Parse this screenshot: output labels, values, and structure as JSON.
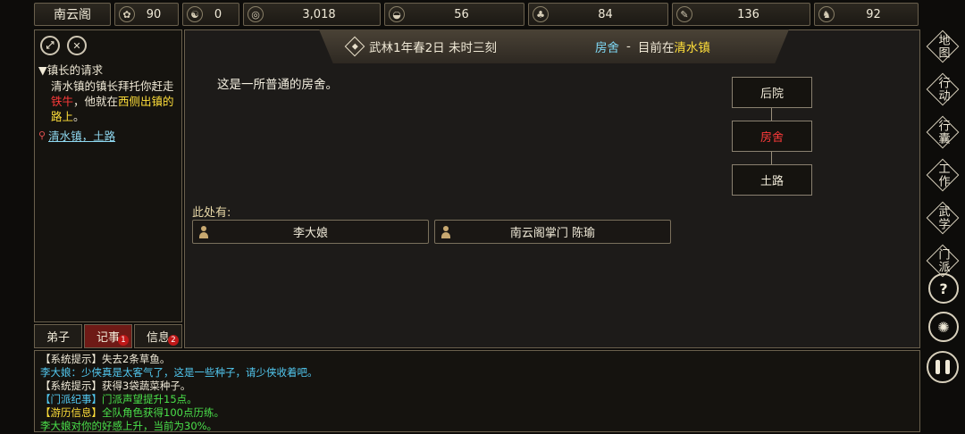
{
  "topbar": {
    "sect_name": "南云阁",
    "stats": [
      {
        "icon": "fame-icon",
        "glyph": "✿",
        "value": "90"
      },
      {
        "icon": "yinyang-icon",
        "glyph": "☯",
        "value": "0"
      },
      {
        "icon": "coin-icon",
        "glyph": "◎",
        "value": "3,018"
      },
      {
        "icon": "food-bowl-icon",
        "glyph": "◒",
        "value": "56"
      },
      {
        "icon": "herb-icon",
        "glyph": "♣",
        "value": "84"
      },
      {
        "icon": "material-icon",
        "glyph": "✎",
        "value": "136"
      },
      {
        "icon": "beast-icon",
        "glyph": "♞",
        "value": "92"
      }
    ]
  },
  "quest": {
    "title": "▼镇长的请求",
    "text_1": "清水镇的镇长拜托你赶走",
    "target": "铁牛",
    "text_2": "，他就在",
    "direction": "西侧出镇的路上",
    "text_3": "。",
    "location": "清水镇，土路"
  },
  "left_tabs": [
    {
      "label": "弟子",
      "badge": ""
    },
    {
      "label": "记事",
      "badge": "1"
    },
    {
      "label": "信息",
      "badge": "2"
    }
  ],
  "header": {
    "date": "武林1年春2日 未时三刻",
    "room": "房舍",
    "separator": "-",
    "now_at": "目前在",
    "town": "清水镇"
  },
  "scene": {
    "description": "这是一所普通的房舍。",
    "here_label": "此处有:",
    "npcs": [
      "李大娘",
      "南云阁掌门 陈瑜"
    ]
  },
  "map": {
    "north": "后院",
    "current": "房舍",
    "south": "土路"
  },
  "log": [
    {
      "color": "white",
      "tag": "【系统提示】",
      "tag_color": "white",
      "text": "失去2条草鱼。"
    },
    {
      "color": "cyan",
      "tag": "",
      "tag_color": "cyan",
      "text": "李大娘：少侠真是太客气了，这是一些种子，请少侠收着吧。"
    },
    {
      "color": "white",
      "tag": "【系统提示】",
      "tag_color": "white",
      "text": "获得3袋蔬菜种子。"
    },
    {
      "color": "green",
      "tag": "【门派纪事】",
      "tag_color": "cyan",
      "text": "门派声望提升15点。"
    },
    {
      "color": "green",
      "tag": "【游历信息】",
      "tag_color": "yellow",
      "text": "全队角色获得100点历练。"
    },
    {
      "color": "green",
      "tag": "",
      "tag_color": "green",
      "text": "李大娘对你的好感上升，当前为30%。"
    }
  ],
  "side_menu": [
    "地图",
    "行动",
    "行囊",
    "工作",
    "武学",
    "门派"
  ],
  "side_round": {
    "help": "?",
    "settings": "✺"
  },
  "colors": {
    "accent_red": "#6e1a16",
    "cyan": "#52c8f0",
    "green": "#4ae04a",
    "yellow": "#ffdf3a"
  }
}
